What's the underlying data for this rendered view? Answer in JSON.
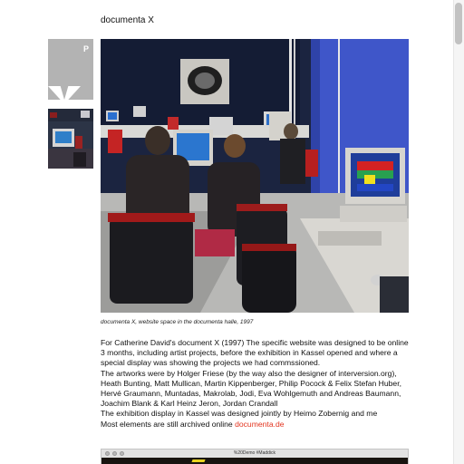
{
  "page": {
    "title": "documenta X"
  },
  "thumbnails": [
    {
      "name": "documenta-logo-thumbnail",
      "letter": "P",
      "accent": "#b3b3b3"
    },
    {
      "name": "computer-room-thumbnail"
    }
  ],
  "photo": {
    "caption": "documenta X, website space in the documenta halle, 1997"
  },
  "article": {
    "p1": "For Catherine David's document X (1997) The specific website was designed to be online 3 months, including artist projects, before the exhibition in Kassel opened and where a special display was showing the projects we had commssioned.",
    "p2": "The artworks were by Holger Friese (by the way also the designer of interversion.org), Heath Bunting, Matt Mullican, Martin Kippenberger, Philip Pocock & Felix Stefan Huber, Hervé Graumann, Muntadas, Makrolab, Jodi, Eva Wohlgemuth and Andreas Baumann, Joachim Blank & Karl Heinz Jeron, Jordan Crandall",
    "p3": "The exhibition display in Kassel was designed jointly by Heimo Zobernig and me",
    "p4_prefix": "Most elements are still archived online ",
    "link_text": "documenta.de",
    "link_color": "#e3341f"
  },
  "demo_window": {
    "title": "%20Demo #Maddick"
  },
  "colors": {
    "background": "#ffffff",
    "text": "#111111",
    "link": "#e3341f"
  }
}
